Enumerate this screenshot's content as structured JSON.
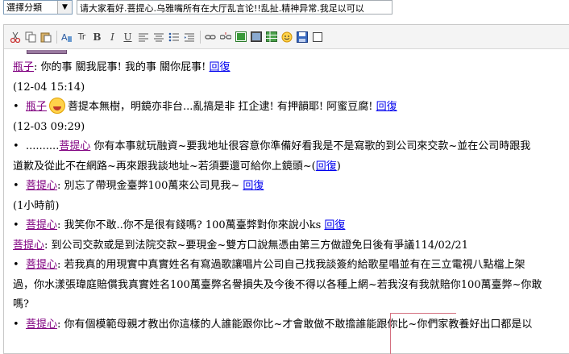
{
  "top": {
    "category_value": "選擇分類",
    "title_value": "请大家看好.菩提心.乌雅嘴所有在大厅乱言论!!乱扯.精神异常.我足以可以"
  },
  "toolbar": {
    "icons": [
      "cut-icon",
      "copy-icon",
      "paste-icon",
      "format-icon",
      "text-size-icon",
      "bold-icon",
      "italic-icon",
      "underline-icon",
      "align-left-icon",
      "align-center-icon",
      "list-icon",
      "indent-icon",
      "link-icon",
      "unlink-icon",
      "image-icon",
      "media-icon",
      "table-icon",
      "emoticon-icon",
      "save-icon",
      "checkbox-icon"
    ],
    "tr_label": "Tr",
    "b_label": "B",
    "i_label": "I",
    "u_label": "U"
  },
  "posts": [
    {
      "name": "瓶子",
      "text": ": 你的事 關我屁事! 我的事 關你屁事!",
      "reply": "回復"
    },
    {
      "time": "(12-04 15:14)"
    },
    {
      "name": "瓶子",
      "text": "菩提本無樹，明鏡亦非台...亂搞是非 扛企逮! 有押韻耶! 阿蜜豆腐!",
      "reply": "回復"
    },
    {
      "time": "(12-03 09:29)"
    },
    {
      "dots": "..........",
      "name": "菩提心",
      "text": "你有本事就玩融資~要我地址很容意你準備好看我是不是寫歌的到公司來交款~並在公司時跟我",
      "cont": "道歉及從此不在網路~再來跟我談地址~若須要還可給你上鏡頭~(",
      "reply": "回復",
      "close": ")"
    },
    {
      "name": "菩提心",
      "text": ": 別忘了帶現金臺弊100萬來公司見我~",
      "reply": "回復"
    },
    {
      "time": "(1小時前)"
    },
    {
      "name": "菩提心",
      "text": ": 我笑你不敢..你不是很有錢嗎? 100萬臺弊對你來說小ks",
      "reply": "回復"
    },
    {
      "name": "菩提心",
      "text": ": 到公司交款或是到法院交款~要現金~雙方口說無憑由第三方做證免日後有爭議114/02/21"
    },
    {
      "name": "菩提心",
      "text": ": 若我真的用現實中真實姓名有寫過歌讓唱片公司自己找我談簽約給歌星唱並有在三立電視八點檔上架",
      "cont": "過，你水漾張瑋庭賠償我真實姓名100萬臺弊名譽損失及今後不得以各種上網~若我沒有我就賠你100萬臺弊~你敢",
      "cont2": "嗎?"
    },
    {
      "name": "菩提心",
      "text": ": 你有個模範母親才教出你這樣的人誰能跟你比~才會敢做不敢擔誰能跟你比~你們家教養好出口都是以"
    }
  ],
  "colors": {
    "name": "#800080",
    "reply": "#0000ee"
  }
}
